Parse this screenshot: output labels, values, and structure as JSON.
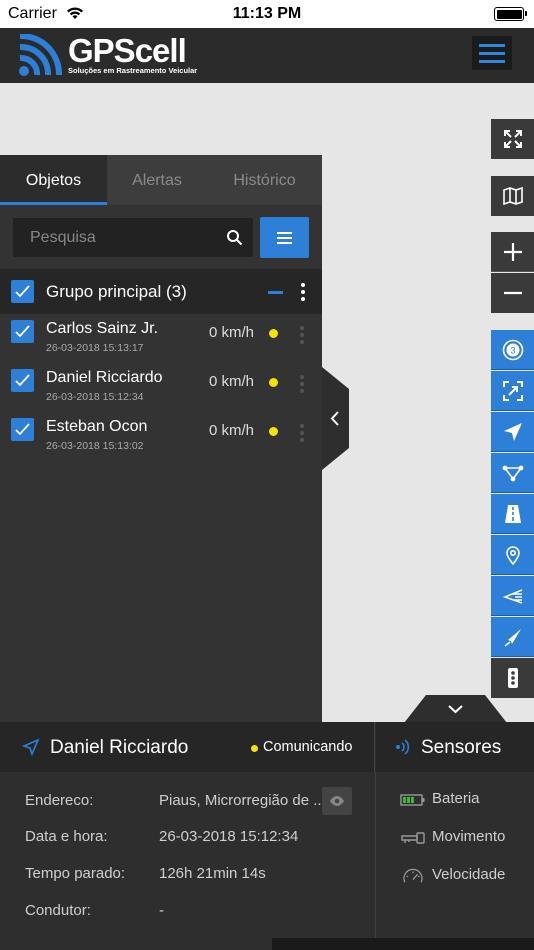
{
  "status_bar": {
    "carrier": "Carrier",
    "time": "11:13 PM"
  },
  "header": {
    "logo_text": "GPScell",
    "logo_subtitle": "Soluções em Rastreamento Veicular"
  },
  "map_controls": [
    "fullscreen-icon",
    "map-icon",
    "zoom-in-icon",
    "zoom-out-icon",
    "cluster-icon",
    "fit-bounds-icon",
    "navigate-icon",
    "route-icon",
    "road-icon",
    "pin-icon",
    "history-icon",
    "send-icon",
    "more-icon"
  ],
  "cluster_count": "3",
  "tabs": [
    {
      "label": "Objetos",
      "active": true
    },
    {
      "label": "Alertas",
      "active": false
    },
    {
      "label": "Histórico",
      "active": false
    }
  ],
  "search": {
    "placeholder": "Pesquisa"
  },
  "group": {
    "title": "Grupo principal (3)"
  },
  "objects": [
    {
      "name": "Carlos Sainz Jr.",
      "timestamp": "26-03-2018 15:13:17",
      "speed": "0 km/h"
    },
    {
      "name": "Daniel Ricciardo",
      "timestamp": "26-03-2018 15:12:34",
      "speed": "0 km/h"
    },
    {
      "name": "Esteban Ocon",
      "timestamp": "26-03-2018 15:13:02",
      "speed": "0 km/h"
    }
  ],
  "info": {
    "name": "Daniel Ricciardo",
    "status": "Comunicando",
    "rows": [
      {
        "label": "Endereco:",
        "value": "Piaus, Microrregião de ..."
      },
      {
        "label": "Data e hora:",
        "value": "26-03-2018 15:12:34"
      },
      {
        "label": "Tempo parado:",
        "value": "126h 21min 14s"
      },
      {
        "label": "Condutor:",
        "value": "-"
      }
    ]
  },
  "sensors": {
    "title": "Sensores",
    "items": [
      {
        "label": "Bateria",
        "icon": "battery-icon"
      },
      {
        "label": "Movimento",
        "icon": "key-icon"
      },
      {
        "label": "Velocidade",
        "icon": "speedometer-icon"
      }
    ]
  },
  "colors": {
    "accent": "#2d7fd8",
    "status_dot": "#f5e400",
    "panel": "#333333",
    "header": "#2b2b2b"
  }
}
